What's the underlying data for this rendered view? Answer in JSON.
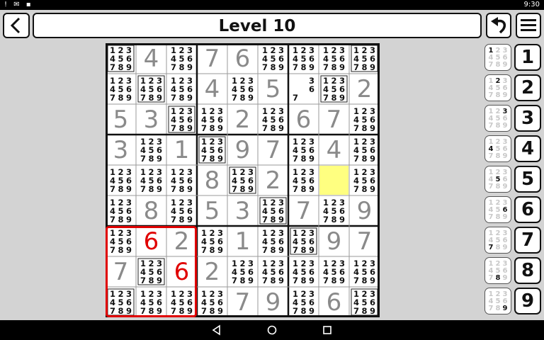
{
  "status": {
    "left_icons": "! ✉ ▪",
    "time": "9:30"
  },
  "header": {
    "title": "Level 10"
  },
  "board": {
    "given": [
      [
        "",
        "4",
        "",
        "7",
        "6",
        "",
        "",
        "",
        ""
      ],
      [
        "",
        "",
        "",
        "4",
        "",
        "5",
        "",
        "",
        "2"
      ],
      [
        "5",
        "3",
        "",
        "",
        "2",
        "",
        "6",
        "7",
        ""
      ],
      [
        "3",
        "",
        "1",
        "",
        "9",
        "7",
        "",
        "4",
        ""
      ],
      [
        "",
        "",
        "",
        "8",
        "",
        "2",
        "",
        "",
        ""
      ],
      [
        "",
        "8",
        "",
        "5",
        "3",
        "",
        "7",
        "",
        "9"
      ],
      [
        "",
        "6",
        "2",
        "",
        "1",
        "",
        "",
        "9",
        "7"
      ],
      [
        "7",
        "",
        "6",
        "2",
        "",
        "",
        "",
        "",
        ""
      ],
      [
        "",
        "",
        "",
        "",
        "7",
        "9",
        "",
        "6",
        ""
      ]
    ],
    "candidates": [
      [
        [
          "1",
          "2",
          "3",
          "4",
          "5",
          "6",
          "7",
          "8",
          "9"
        ],
        [],
        [
          "1",
          "2",
          "3",
          "4",
          "5",
          "6",
          "7",
          "8",
          "9"
        ],
        [],
        [],
        [
          "1",
          "2",
          "3",
          "4",
          "5",
          "6",
          "7",
          "8",
          "9"
        ],
        [
          "1",
          "2",
          "3",
          "4",
          "5",
          "6",
          "7",
          "8",
          "9"
        ],
        [
          "1",
          "2",
          "3",
          "4",
          "5",
          "6",
          "7",
          "8",
          "9"
        ],
        [
          "1",
          "2",
          "3",
          "4",
          "5",
          "6",
          "7",
          "8",
          "9"
        ]
      ],
      [
        [
          "1",
          "2",
          "3",
          "4",
          "5",
          "6",
          "7",
          "8",
          "9"
        ],
        [
          "1",
          "2",
          "3",
          "4",
          "5",
          "6",
          "7",
          "8",
          "9"
        ],
        [
          "1",
          "2",
          "3",
          "4",
          "5",
          "6",
          "7",
          "8",
          "9"
        ],
        [],
        [
          "1",
          "2",
          "3",
          "4",
          "5",
          "6",
          "7",
          "8",
          "9"
        ],
        [],
        [
          "3",
          "6",
          "7"
        ],
        [
          "1",
          "2",
          "3",
          "4",
          "5",
          "6",
          "7",
          "8",
          "9"
        ],
        []
      ],
      [
        [],
        [],
        [
          "1",
          "2",
          "3",
          "4",
          "5",
          "6",
          "7",
          "8",
          "9"
        ],
        [
          "1",
          "2",
          "3",
          "4",
          "5",
          "6",
          "7",
          "8",
          "9"
        ],
        [],
        [
          "1",
          "2",
          "3",
          "4",
          "5",
          "6",
          "7",
          "8",
          "9"
        ],
        [],
        [],
        [
          "1",
          "2",
          "3",
          "4",
          "5",
          "6",
          "7",
          "8",
          "9"
        ]
      ],
      [
        [],
        [
          "1",
          "2",
          "3",
          "4",
          "5",
          "6",
          "7",
          "8",
          "9"
        ],
        [],
        [
          "1",
          "2",
          "3",
          "4",
          "5",
          "6",
          "7",
          "8",
          "9"
        ],
        [],
        [],
        [
          "1",
          "2",
          "3",
          "4",
          "5",
          "6",
          "7",
          "8",
          "9"
        ],
        [],
        [
          "1",
          "2",
          "3",
          "4",
          "5",
          "6",
          "7",
          "8",
          "9"
        ]
      ],
      [
        [
          "1",
          "2",
          "3",
          "4",
          "5",
          "6",
          "7",
          "8",
          "9"
        ],
        [
          "1",
          "2",
          "3",
          "4",
          "5",
          "6",
          "7",
          "8",
          "9"
        ],
        [
          "1",
          "2",
          "3",
          "4",
          "5",
          "6",
          "7",
          "8",
          "9"
        ],
        [],
        [
          "1",
          "2",
          "3",
          "4",
          "5",
          "6",
          "7",
          "8",
          "9"
        ],
        [],
        [
          "1",
          "2",
          "3",
          "4",
          "5",
          "6",
          "7",
          "8",
          "9"
        ],
        [],
        [
          "1",
          "2",
          "3",
          "4",
          "5",
          "6",
          "7",
          "8",
          "9"
        ]
      ],
      [
        [
          "1",
          "2",
          "3",
          "4",
          "5",
          "6",
          "7",
          "8",
          "9"
        ],
        [],
        [
          "1",
          "2",
          "3",
          "4",
          "5",
          "6",
          "7",
          "8",
          "9"
        ],
        [],
        [],
        [
          "1",
          "2",
          "3",
          "4",
          "5",
          "6",
          "7",
          "8",
          "9"
        ],
        [],
        [
          "1",
          "2",
          "3",
          "4",
          "5",
          "6",
          "7",
          "8",
          "9"
        ],
        []
      ],
      [
        [
          "1",
          "2",
          "3",
          "4",
          "5",
          "6",
          "7",
          "8",
          "9"
        ],
        [],
        [],
        [
          "1",
          "2",
          "3",
          "4",
          "5",
          "6",
          "7",
          "8",
          "9"
        ],
        [],
        [
          "1",
          "2",
          "3",
          "4",
          "5",
          "6",
          "7",
          "8",
          "9"
        ],
        [
          "1",
          "2",
          "3",
          "4",
          "5",
          "6",
          "7",
          "8",
          "9"
        ],
        [],
        []
      ],
      [
        [],
        [
          "1",
          "2",
          "3",
          "4",
          "5",
          "6",
          "7",
          "8",
          "9"
        ],
        [],
        [],
        [
          "1",
          "2",
          "3",
          "4",
          "5",
          "6",
          "7",
          "8",
          "9"
        ],
        [
          "1",
          "2",
          "3",
          "4",
          "5",
          "6",
          "7",
          "8",
          "9"
        ],
        [
          "1",
          "2",
          "3",
          "4",
          "5",
          "6",
          "7",
          "8",
          "9"
        ],
        [
          "1",
          "2",
          "3",
          "4",
          "5",
          "6",
          "7",
          "8",
          "9"
        ],
        [
          "1",
          "2",
          "3",
          "4",
          "5",
          "6",
          "7",
          "8",
          "9"
        ]
      ],
      [
        [
          "1",
          "2",
          "3",
          "4",
          "5",
          "6",
          "7",
          "8",
          "9"
        ],
        [
          "1",
          "2",
          "3",
          "4",
          "5",
          "6",
          "7",
          "8",
          "9"
        ],
        [
          "1",
          "2",
          "3",
          "4",
          "5",
          "6",
          "7",
          "8",
          "9"
        ],
        [
          "1",
          "2",
          "3",
          "4",
          "5",
          "6",
          "7",
          "8",
          "9"
        ],
        [],
        [],
        [
          "1",
          "2",
          "3",
          "4",
          "5",
          "6",
          "7",
          "8",
          "9"
        ],
        [],
        [
          "1",
          "2",
          "3",
          "4",
          "5",
          "6",
          "7",
          "8",
          "9"
        ]
      ]
    ],
    "boxed_cells": [
      [
        0,
        0
      ],
      [
        0,
        8
      ],
      [
        1,
        1
      ],
      [
        1,
        7
      ],
      [
        2,
        2
      ],
      [
        2,
        6
      ],
      [
        3,
        3
      ],
      [
        3,
        5
      ],
      [
        4,
        4
      ],
      [
        5,
        3
      ],
      [
        5,
        5
      ],
      [
        6,
        2
      ],
      [
        6,
        6
      ],
      [
        7,
        1
      ],
      [
        8,
        0
      ],
      [
        8,
        8
      ]
    ],
    "conflict_cells": [
      [
        6,
        1
      ],
      [
        7,
        2
      ]
    ],
    "selected_cell": [
      4,
      7
    ],
    "highlight_box": 6,
    "colors": {
      "given": "#8a8a8a",
      "conflict": "#e00000",
      "selected": "#ffff80",
      "highlight": "#e00000",
      "candidate": "#111111"
    }
  },
  "keypad": {
    "numbers": [
      "1",
      "2",
      "3",
      "4",
      "5",
      "6",
      "7",
      "8",
      "9"
    ]
  },
  "navbar": {
    "back_icon": "nav-back-triangle",
    "home_icon": "nav-home-circle",
    "recents_icon": "nav-recents-square"
  }
}
